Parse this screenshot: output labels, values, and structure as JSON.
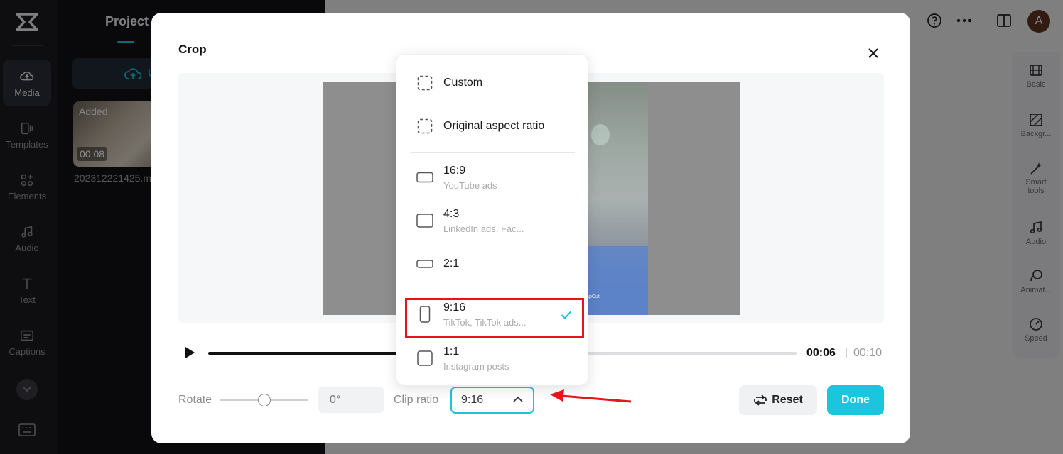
{
  "left_rail": {
    "items": [
      {
        "label": "Media",
        "icon": "media-icon"
      },
      {
        "label": "Templates",
        "icon": "templates-icon"
      },
      {
        "label": "Elements",
        "icon": "elements-icon"
      },
      {
        "label": "Audio",
        "icon": "audio-icon"
      },
      {
        "label": "Text",
        "icon": "text-icon"
      },
      {
        "label": "Captions",
        "icon": "captions-icon"
      }
    ]
  },
  "media_panel": {
    "title": "Project",
    "upload_label": "U",
    "thumb": {
      "badge": "Added",
      "duration": "00:08",
      "filename": "202312221425.m"
    }
  },
  "right_rail": {
    "items": [
      {
        "label": "Basic"
      },
      {
        "label": "Backgr..."
      },
      {
        "label": "Smart tools"
      },
      {
        "label": "Audio"
      },
      {
        "label": "Animat..."
      },
      {
        "label": "Speed"
      }
    ]
  },
  "topbar": {
    "avatar_initial": "A"
  },
  "modal": {
    "title": "Crop",
    "watermark": "CapCut",
    "time_current": "00:06",
    "time_separator": "|",
    "time_total": "00:10",
    "progress_fraction": 0.6,
    "rotate_label": "Rotate",
    "rotate_value": "0°",
    "clip_ratio_label": "Clip ratio",
    "clip_ratio_value": "9:16",
    "reset_label": "Reset",
    "done_label": "Done"
  },
  "dropdown": {
    "items": [
      {
        "label": "Custom",
        "sub": "",
        "icon": "custom-ratio-icon"
      },
      {
        "label": "Original aspect ratio",
        "sub": "",
        "icon": "original-ratio-icon"
      },
      {
        "label": "16:9",
        "sub": "YouTube ads",
        "icon": "ratio-16-9-icon"
      },
      {
        "label": "4:3",
        "sub": "LinkedIn ads, Fac...",
        "icon": "ratio-4-3-icon"
      },
      {
        "label": "2:1",
        "sub": "",
        "icon": "ratio-2-1-icon"
      },
      {
        "label": "9:16",
        "sub": "TikTok, TikTok ads...",
        "icon": "ratio-9-16-icon",
        "selected": true
      },
      {
        "label": "1:1",
        "sub": "Instagram posts",
        "icon": "ratio-1-1-icon"
      }
    ]
  },
  "colors": {
    "accent": "#1cc5de",
    "highlight": "#e8141c"
  }
}
